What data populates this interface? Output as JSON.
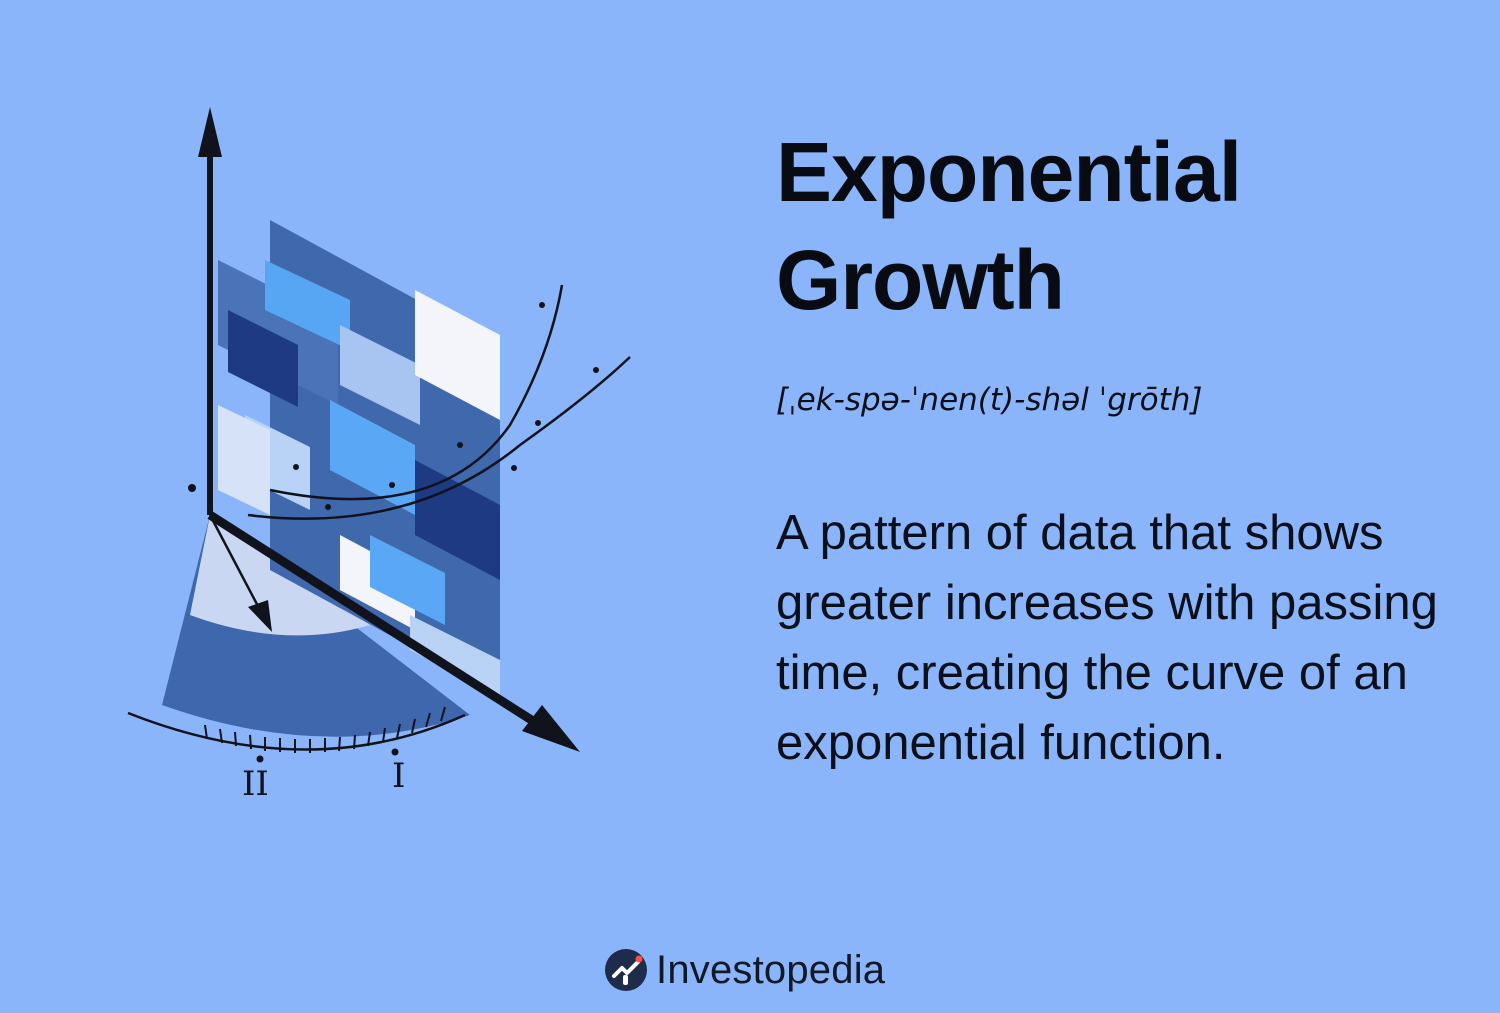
{
  "title_lines": [
    "Exponential",
    "Growth"
  ],
  "pronunciation": "[ˌek-spə-ˈnen(t)-shəl ˈgrōth]",
  "definition": "A pattern of data that shows greater increases with passing time, creating the curve of an exponential function.",
  "brand": {
    "name": "Investopedia",
    "logo_icon": "investopedia-logo-icon"
  },
  "illustration": {
    "icon": "exponential-chart-illustration-icon",
    "gauge_labels": [
      "II",
      "I"
    ]
  },
  "colors": {
    "background": "#8bb5fb",
    "text": "#0b0f1a",
    "dark_blue": "#1f3f8a",
    "mid_blue": "#4a73b8",
    "light_blue": "#5aa8f5",
    "white": "#f4f6fb"
  }
}
